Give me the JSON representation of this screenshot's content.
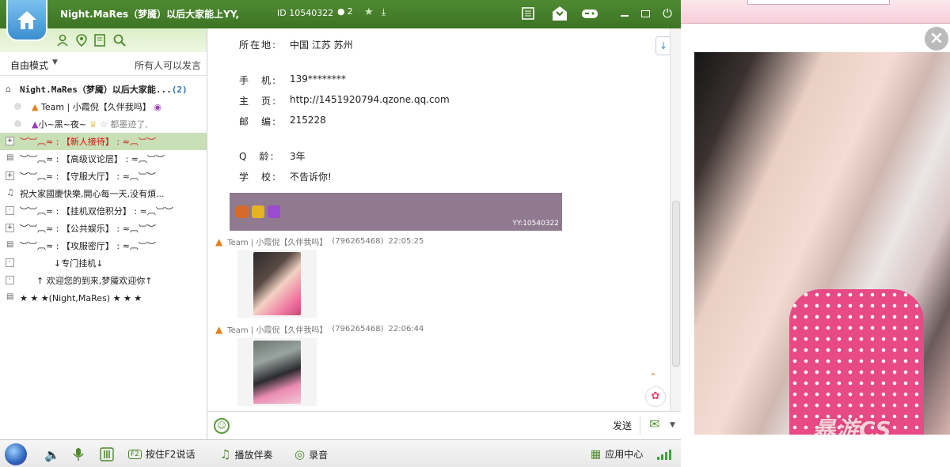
{
  "topbar": {
    "channel_title": "Night.MaRes（梦魇）以后大家能上YY,",
    "channel_id": "ID 10540322",
    "online_count": "2",
    "icons": [
      "home-icon",
      "list-icon",
      "yy-icon",
      "gamepad-icon",
      "minimize-icon",
      "maximize-icon",
      "power-icon"
    ]
  },
  "left": {
    "mode_label": "自由模式",
    "speak_rule": "所有人可以发言",
    "tree": [
      {
        "text": "Night.MaRes（梦魇）以后大家能...",
        "count": "(2)",
        "kind": "root"
      },
      {
        "text": "Team | 小霞倪【久伴我吗】",
        "kind": "user"
      },
      {
        "text": "小~黑~夜~",
        "suffix": "都墨迹了,",
        "kind": "user"
      },
      {
        "text": "【新人接待】",
        "kind": "channel",
        "selected": true
      },
      {
        "text": "【高级议论层】",
        "kind": "channel"
      },
      {
        "text": "【守服大厅】",
        "kind": "channel"
      },
      {
        "text": "祝大家國慶快樂,開心每一天,没有煩...",
        "kind": "music"
      },
      {
        "text": "【挂机双倍积分】",
        "kind": "channel"
      },
      {
        "text": "【公共娱乐】",
        "kind": "channel"
      },
      {
        "text": "【攻服密厅】",
        "kind": "channel"
      },
      {
        "text": "↓专门挂机↓",
        "kind": "plain"
      },
      {
        "text": "↑ 欢迎您的到来,梦魇欢迎你↑",
        "kind": "plain"
      },
      {
        "text": "★ ★ ★(Night,MaRes) ★ ★ ★",
        "kind": "channel"
      }
    ]
  },
  "profile": {
    "location_k": "所在地:",
    "location_v": "中国 江苏 苏州",
    "phone_k": "手　机:",
    "phone_v": "139********",
    "home_k": "主　页:",
    "home_v": "http://1451920794.qzone.qq.com",
    "zip_k": "邮　编:",
    "zip_v": "215228",
    "qage_k": "Q　龄:",
    "qage_v": "3年",
    "school_k": "学　校:",
    "school_v": "不告诉你!",
    "footer": "YY:10540322"
  },
  "messages": [
    {
      "sender": "Team | 小霞倪【久伴我吗】",
      "qq": "(796265468)",
      "time": "22:05:25"
    },
    {
      "sender": "Team | 小霞倪【久伴我吗】",
      "qq": "(796265468)",
      "time": "22:06:44"
    }
  ],
  "input": {
    "send_label": "发送"
  },
  "bottombar": {
    "f2_label": "按住F2说话",
    "music_label": "播放伴奏",
    "record_label": "录音",
    "apps_label": "应用中心"
  },
  "viewer": {
    "watermark": "暴游CS"
  }
}
